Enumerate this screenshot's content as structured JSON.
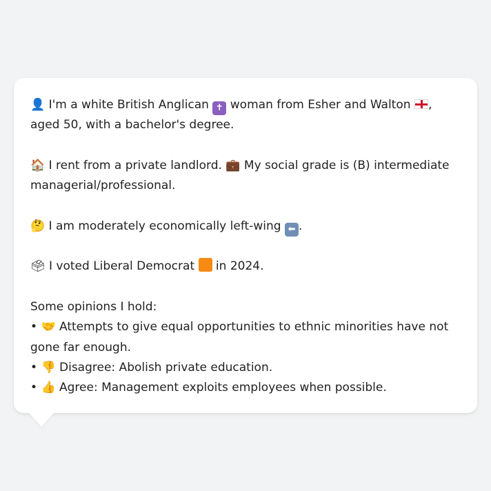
{
  "profile": {
    "intro": {
      "icon": "person-silhouette-icon",
      "text_a": "I'm a white British Anglican",
      "religion_icon": "latin-cross-icon",
      "religion_icon_color": "#8b5fbf",
      "text_b": "woman from Esher and Walton",
      "flag_icon": "england-flag-icon",
      "text_c": ", aged 50, with a bachelor's degree."
    },
    "housing": {
      "icon": "house-icon",
      "text_a": "I rent from a private landlord.",
      "grade_icon": "briefcase-icon",
      "text_b": "My social grade is (B) intermediate managerial/professional."
    },
    "economics": {
      "icon": "thinking-face-icon",
      "text_a": "I am moderately economically left-wing",
      "direction_icon": "left-arrow-icon",
      "direction_icon_color": "#6f8fb4",
      "text_b": "."
    },
    "vote": {
      "icon": "ballot-box-icon",
      "text_a": "I voted Liberal Democrat",
      "party_icon": "orange-square-icon",
      "party_color": "#f68a12",
      "text_b": "in 2024."
    },
    "opinions": {
      "heading": "Some opinions I hold:",
      "bullet": "•",
      "items": [
        {
          "icon": "handshake-icon",
          "text": "Attempts to give equal opportunities to ethnic minorities have not gone far enough."
        },
        {
          "icon": "thumbs-down-icon",
          "text": "Disagree: Abolish private education."
        },
        {
          "icon": "thumbs-up-icon",
          "text": "Agree: Management exploits employees when possible."
        }
      ]
    }
  }
}
